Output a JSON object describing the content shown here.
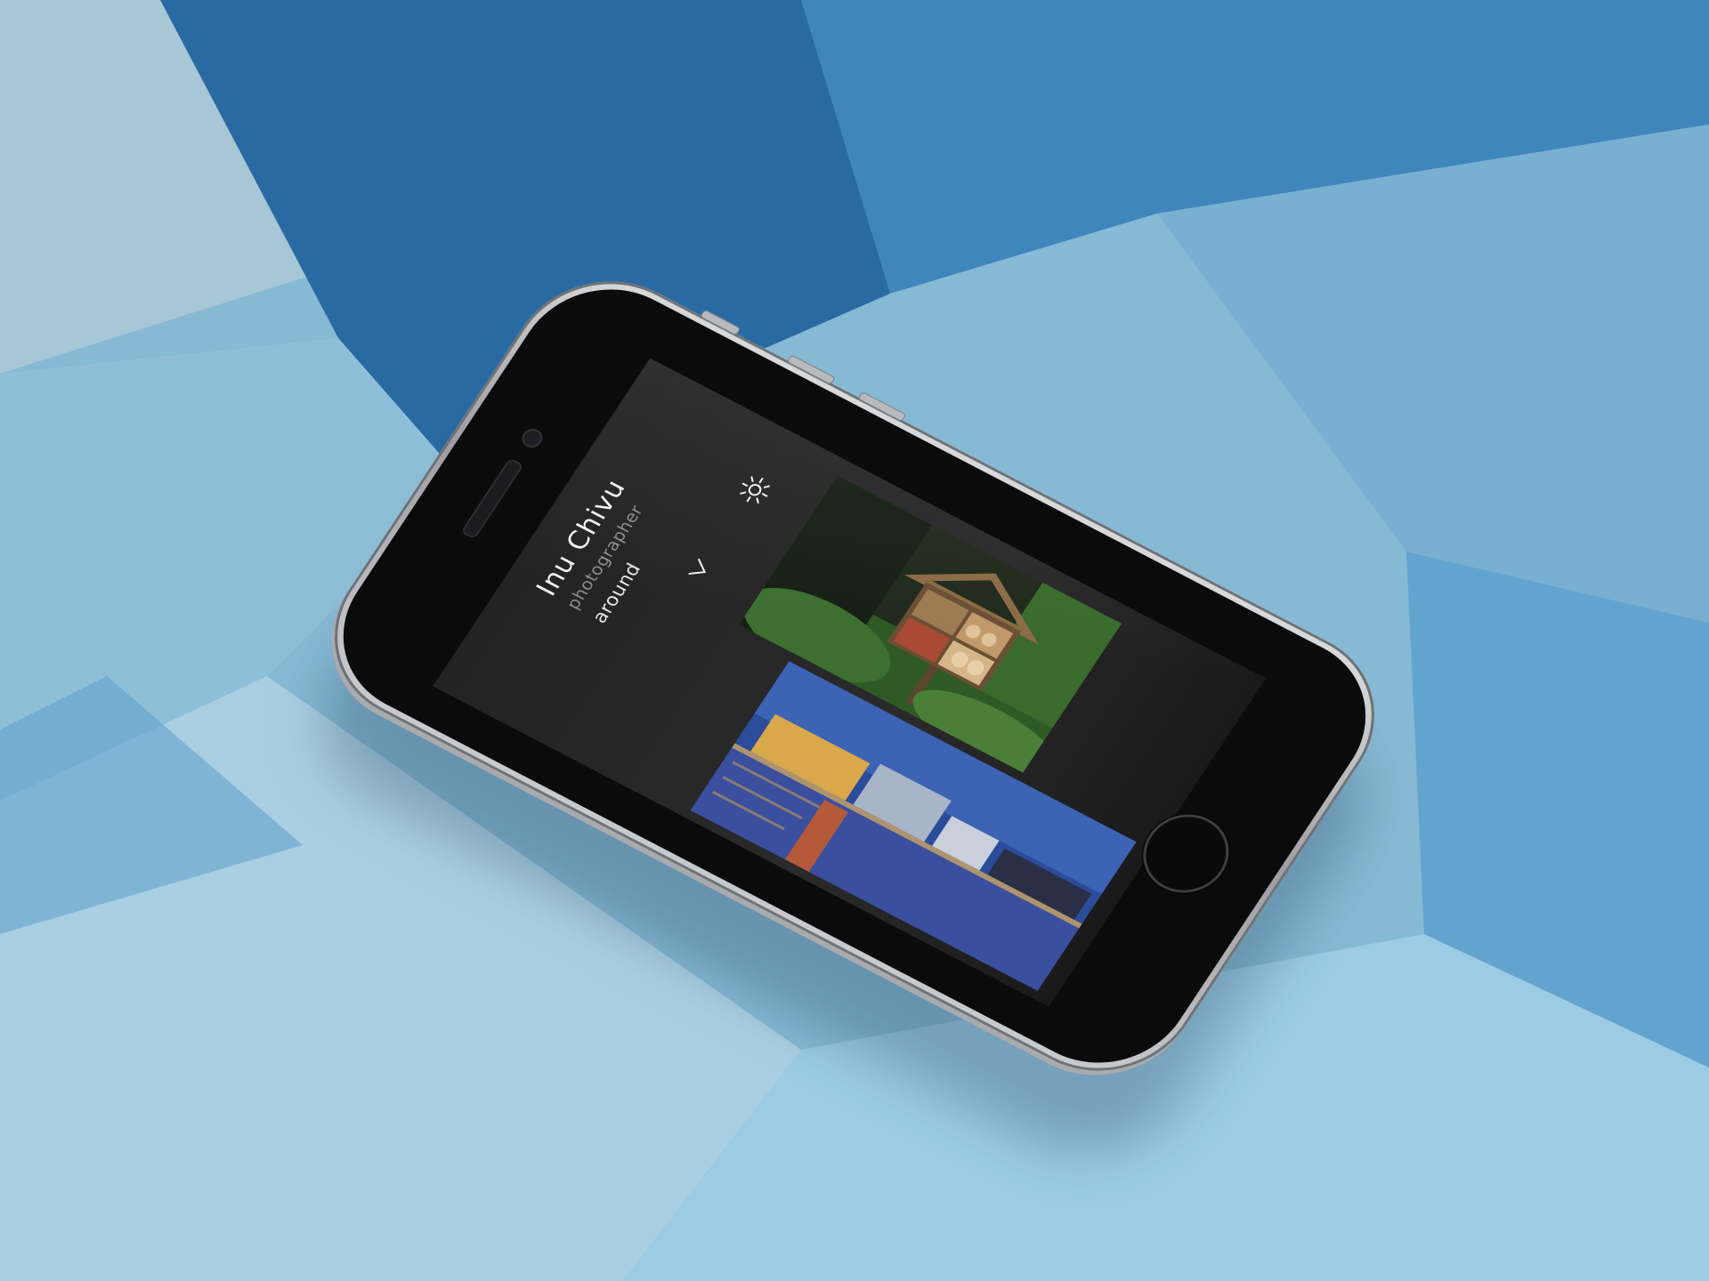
{
  "scene": {
    "background_colors": [
      "#1f5c93",
      "#6ea8cc",
      "#9cc7df",
      "#3d7fb6"
    ]
  },
  "device": {
    "model_color": "#a9abae"
  },
  "profile": {
    "name": "Inu Chivu",
    "role": "photographer",
    "location": "around"
  },
  "controls": {
    "expand_icon": "chevron-down-icon",
    "theme_icon": "sun-icon"
  },
  "gallery": {
    "items": [
      {
        "subject": "insect hotel in garden"
      },
      {
        "subject": "riverside city at dusk"
      }
    ]
  },
  "colors": {
    "screen_bg": "#232324",
    "text_primary": "#f2f2f2",
    "text_secondary": "#8d8d8f"
  }
}
